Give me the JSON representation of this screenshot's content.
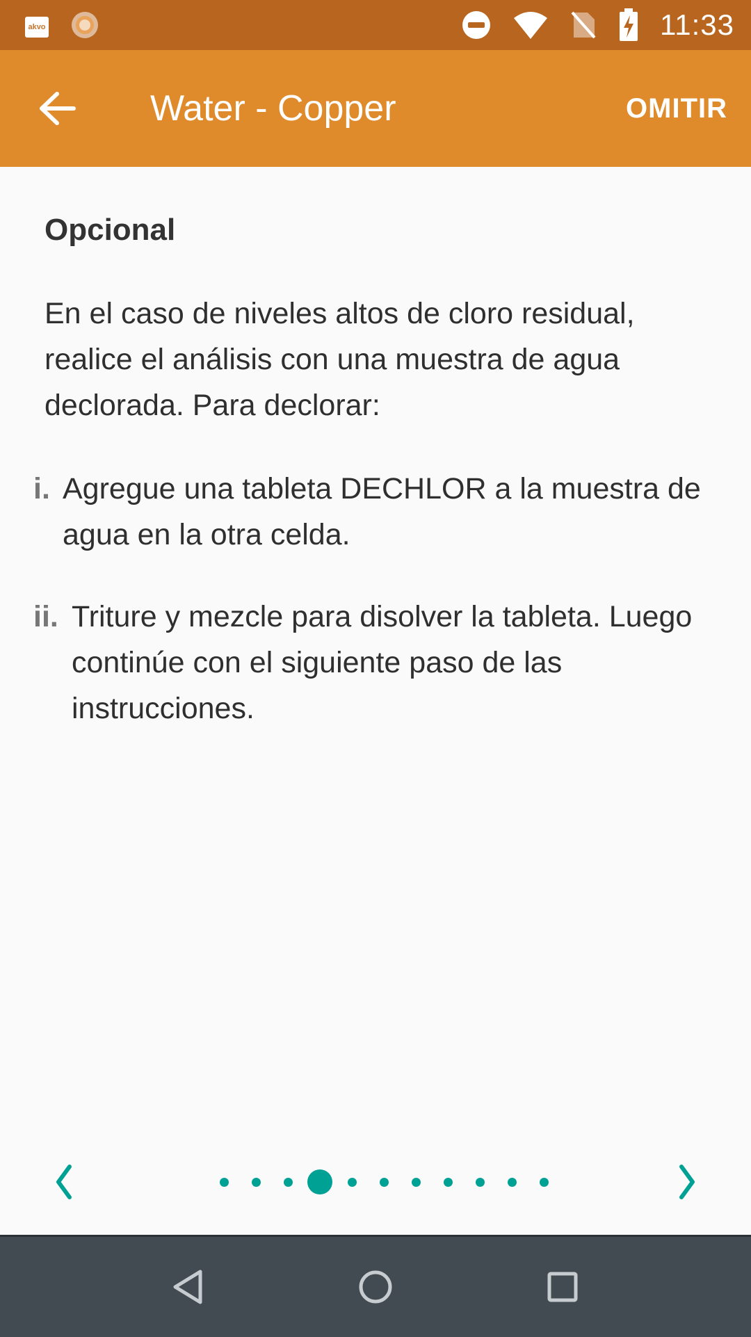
{
  "status_bar": {
    "app_icon_label": "akvo",
    "time": "11:33"
  },
  "app_bar": {
    "title": "Water - Copper",
    "skip_label": "OMITIR"
  },
  "content": {
    "heading": "Opcional",
    "intro": "En el caso de niveles altos de cloro residual, realice el análisis con una muestra de agua declorada. Para declorar:",
    "steps": [
      {
        "num": "i.",
        "text": "Agregue una tableta DECHLOR a la muestra de agua en la otra celda."
      },
      {
        "num": "ii.",
        "text": "Triture y mezcle para disolver la tableta. Luego continúe con el siguiente paso de las instrucciones."
      }
    ]
  },
  "pager": {
    "total_pages": 11,
    "current_page": 4
  },
  "colors": {
    "status_bar": "#b8661f",
    "app_bar": "#df8a2b",
    "accent": "#00a195",
    "nav_bar": "#424a52"
  },
  "icons": {
    "back": "arrow-left-icon",
    "prev": "chevron-left-icon",
    "next": "chevron-right-icon",
    "nav_back": "triangle-back-icon",
    "nav_home": "circle-home-icon",
    "nav_recents": "square-recents-icon"
  }
}
